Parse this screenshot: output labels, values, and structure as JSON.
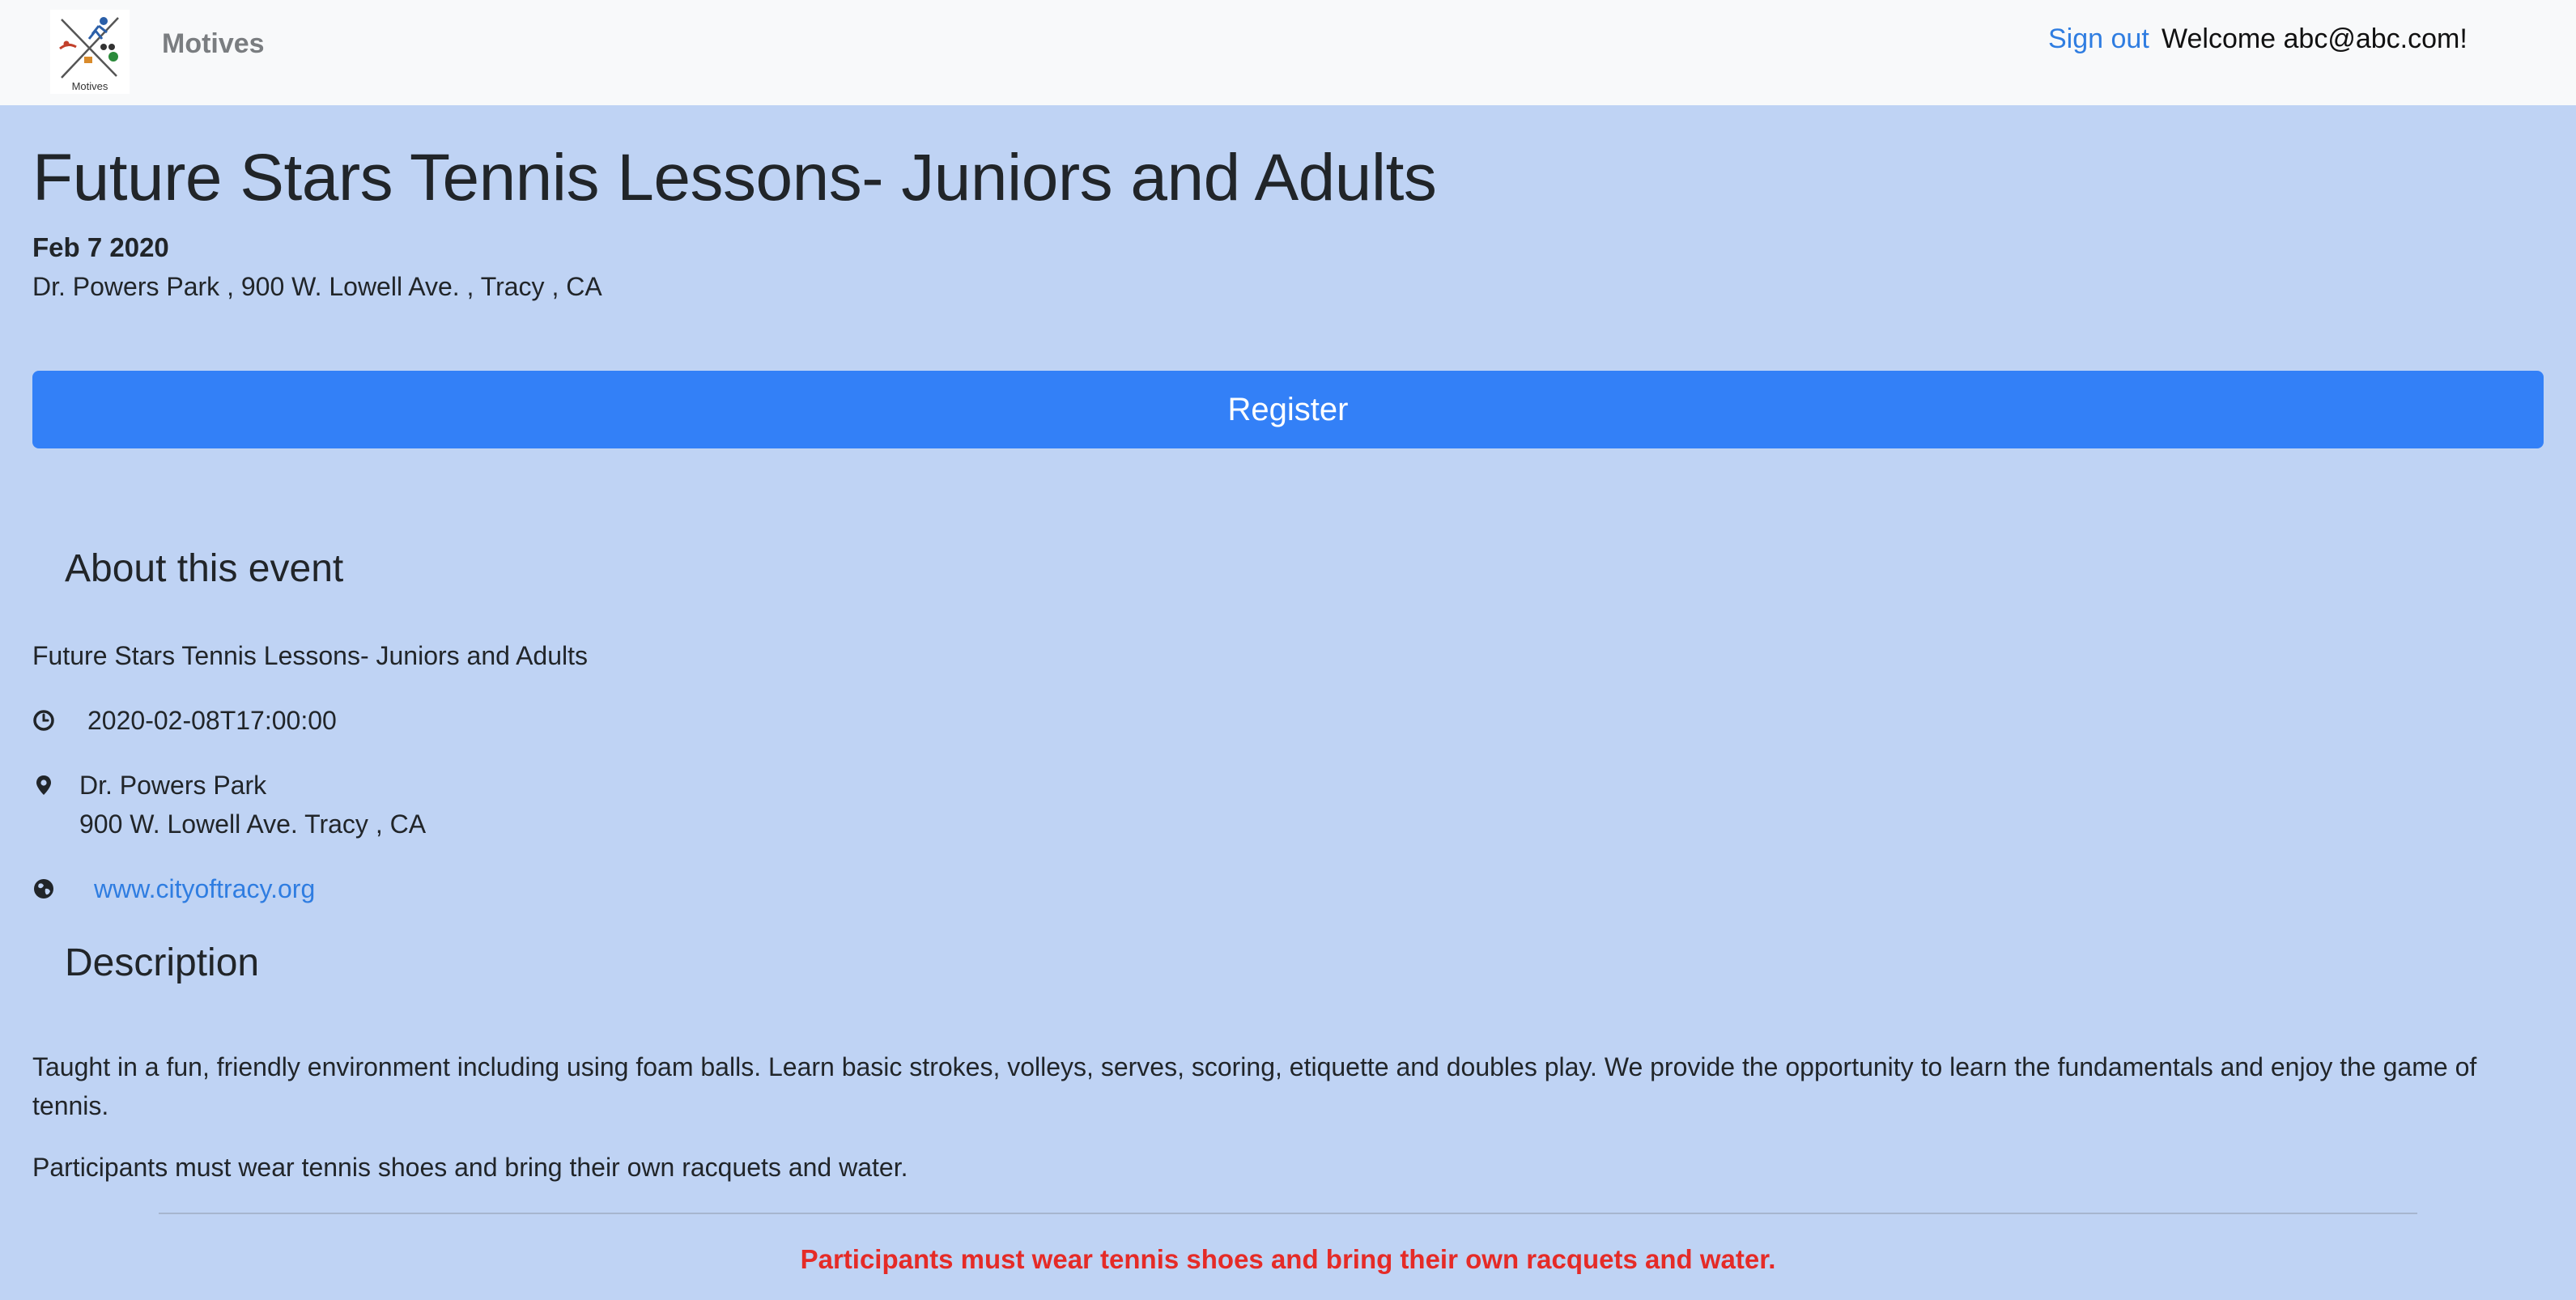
{
  "navbar": {
    "brand": "Motives",
    "logo_text": "Motives",
    "signout_label": "Sign out",
    "welcome_text": "Welcome abc@abc.com!"
  },
  "event": {
    "title": "Future Stars Tennis Lessons- Juniors and Adults",
    "date": "Feb 7 2020",
    "address_line": "Dr. Powers Park , 900 W. Lowell Ave. , Tracy , CA",
    "register_label": "Register"
  },
  "about": {
    "heading": "About this event",
    "name": "Future Stars Tennis Lessons- Juniors and Adults",
    "datetime": "2020-02-08T17:00:00",
    "venue_name": "Dr. Powers Park",
    "venue_address": "900 W. Lowell Ave. Tracy , CA",
    "website": "www.cityoftracy.org"
  },
  "description": {
    "heading": "Description",
    "paragraph1": "Taught in a fun, friendly environment including using foam balls. Learn basic strokes, volleys, serves, scoring, etiquette and doubles play. We provide the opportunity to learn the fundamentals and enjoy the game of tennis.",
    "paragraph2": "Participants must wear tennis shoes and bring their own racquets and water.",
    "warning": "Participants must wear tennis shoes and bring their own racquets and water."
  },
  "icons": {
    "clock": "clock-icon",
    "pin": "map-marker-icon",
    "globe": "globe-icon"
  },
  "colors": {
    "page_background": "#bfd3f4",
    "navbar_background": "#f8f9fa",
    "primary_button": "#3380f7",
    "link": "#2f7de1",
    "warning_text": "#e52b27"
  }
}
